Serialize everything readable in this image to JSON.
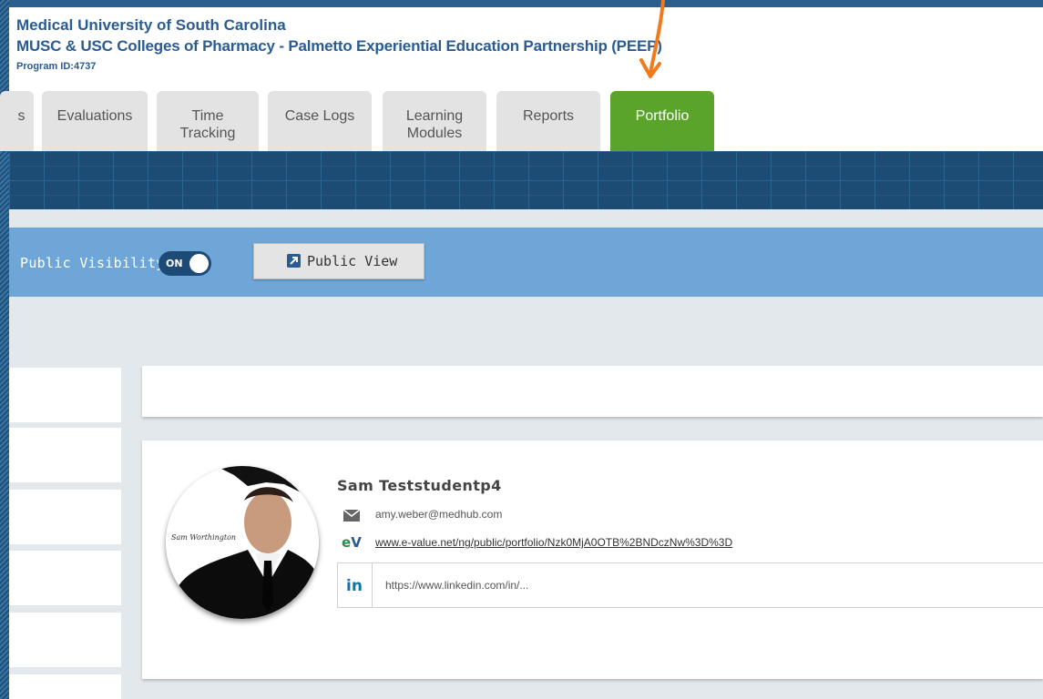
{
  "header": {
    "institution": "Medical University of South Carolina",
    "program": "MUSC & USC Colleges of Pharmacy - Palmetto Experiential Education Partnership (PEEP)",
    "program_id": "Program ID:4737"
  },
  "tabs": [
    {
      "label": "s"
    },
    {
      "label": "Evaluations"
    },
    {
      "label": "Time Tracking"
    },
    {
      "label": "Case Logs"
    },
    {
      "label": "Learning Modules"
    },
    {
      "label": "Reports"
    },
    {
      "label": "Portfolio",
      "active": true
    }
  ],
  "visibility": {
    "label": "Public Visibility",
    "toggle_state": "ON",
    "public_view_label": "Public View"
  },
  "profile": {
    "name": "Sam Teststudentp4",
    "avatar_signature": "Sam Worthington",
    "email": "amy.weber@medhub.com",
    "portfolio_url": "www.e-value.net/ng/public/portfolio/Nzk0MjA0OTB%2BNDczNw%3D%3D",
    "linkedin_value": "https://www.linkedin.com/in/..."
  },
  "colors": {
    "brand_blue": "#2a5c93",
    "active_tab": "#5aa42b",
    "annotation_arrow": "#f07a1c"
  },
  "icons": {
    "email": "envelope-icon",
    "evalue": "evalue-logo-icon",
    "linkedin": "linkedin-icon",
    "public_view": "external-link-icon"
  }
}
